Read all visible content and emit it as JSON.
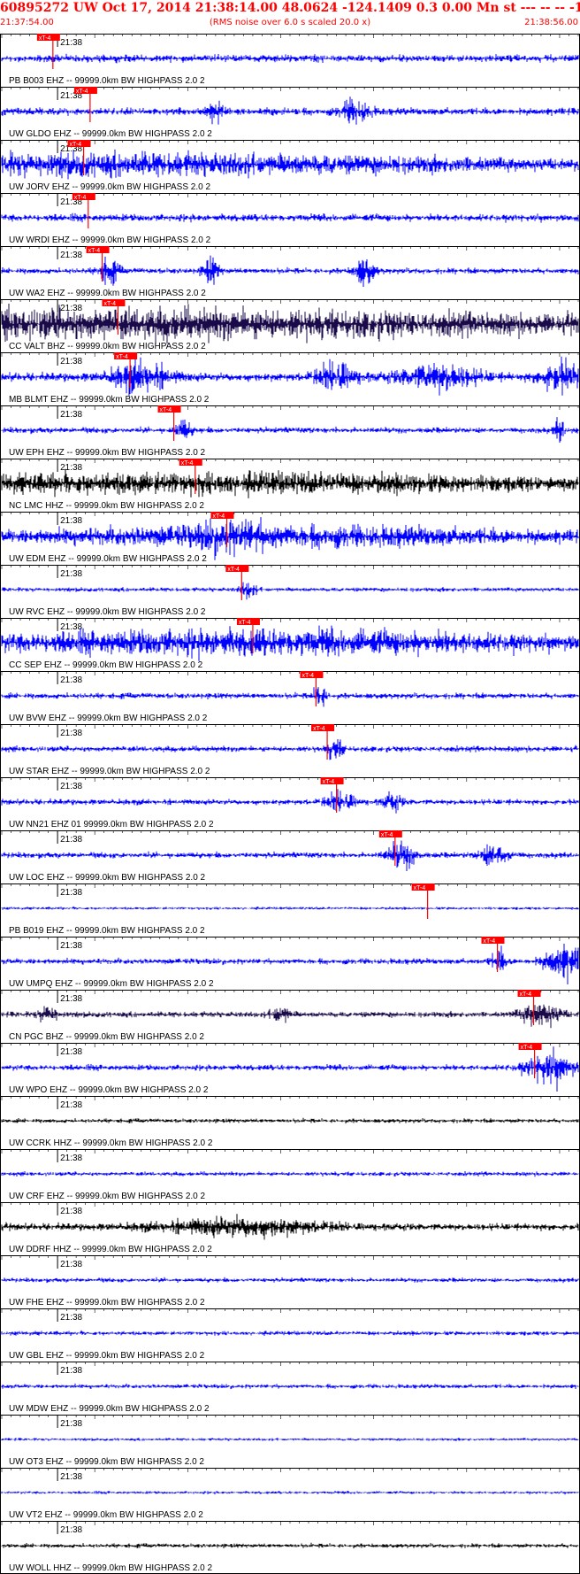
{
  "header": {
    "title": "60895272 UW Oct 17, 2014 21:38:14.00   48.0624 -124.1409  0.3 0.00 Mn st --- -- --  -1",
    "start_time": "21:37:54.00",
    "subtitle": "(RMS noise over 6.0 s scaled 20.0 x)",
    "end_time": "21:38:56.00"
  },
  "chart_data": {
    "type": "seismogram",
    "time_range": [
      "21:37:54.00",
      "21:38:56.00"
    ],
    "time_tick_label": "21:38",
    "pick_label": "xT-4",
    "trace_suffix": "99999.0km BW  HIGHPASS  2.0  2",
    "colors": {
      "blue": "#0000ff",
      "navy": "#1a0a4a",
      "black": "#000000",
      "red": "#ff0000"
    },
    "traces": [
      {
        "station": "PB B003 EHZ --",
        "color": "blue",
        "pick_s": 5.5,
        "amp": 5,
        "bursts": []
      },
      {
        "station": "UW GLDO EHZ --",
        "color": "blue",
        "pick_s": 9.5,
        "amp": 5,
        "bursts": [
          [
            23,
            0.8,
            14
          ],
          [
            38,
            1.5,
            16
          ]
        ]
      },
      {
        "station": "UW JORV EHZ --",
        "color": "blue",
        "pick_s": 8.8,
        "amp": 4,
        "bursts": [
          [
            10,
            50,
            14
          ]
        ]
      },
      {
        "station": "UW WRDI EHZ --",
        "color": "blue",
        "pick_s": 9.3,
        "amp": 5,
        "bursts": []
      },
      {
        "station": "UW WA2 EHZ --",
        "color": "blue",
        "pick_s": 10.8,
        "amp": 4,
        "bursts": [
          [
            11.5,
            1.0,
            18
          ],
          [
            22.5,
            0.8,
            18
          ],
          [
            39,
            1.0,
            20
          ]
        ]
      },
      {
        "station": "CC VALT BHZ --",
        "color": "navy",
        "pick_s": 12.5,
        "amp": 8,
        "bursts": [
          [
            13,
            50,
            16
          ]
        ]
      },
      {
        "station": "MB BLMT EHZ --",
        "color": "blue",
        "pick_s": 13.8,
        "amp": 6,
        "bursts": [
          [
            15,
            3,
            20
          ],
          [
            36,
            2,
            20
          ],
          [
            47,
            4,
            18
          ],
          [
            60,
            2,
            22
          ]
        ]
      },
      {
        "station": "UW EPH EHZ --",
        "color": "blue",
        "pick_s": 18.5,
        "amp": 4,
        "bursts": [
          [
            19.5,
            0.8,
            14
          ],
          [
            60,
            0.5,
            18
          ]
        ]
      },
      {
        "station": "NC LMC HHZ --",
        "color": "black",
        "pick_s": 20.8,
        "amp": 5,
        "bursts": [
          [
            22,
            40,
            12
          ]
        ]
      },
      {
        "station": "UW EDM EHZ --",
        "color": "blue",
        "pick_s": 24.2,
        "amp": 5,
        "bursts": [
          [
            25,
            3,
            18
          ],
          [
            30,
            30,
            12
          ]
        ]
      },
      {
        "station": "UW RVC EHZ --",
        "color": "blue",
        "pick_s": 25.8,
        "amp": 3,
        "bursts": [
          [
            26.5,
            0.8,
            12
          ]
        ]
      },
      {
        "station": "CC SEP EHZ --",
        "color": "blue",
        "pick_s": 27.0,
        "amp": 6,
        "bursts": [
          [
            28,
            34,
            14
          ]
        ]
      },
      {
        "station": "UW BVW EHZ --",
        "color": "blue",
        "pick_s": 33.8,
        "amp": 4,
        "bursts": [
          [
            34.2,
            0.6,
            20
          ]
        ]
      },
      {
        "station": "UW STAR EHZ --",
        "color": "blue",
        "pick_s": 35.0,
        "amp": 4,
        "bursts": [
          [
            35.8,
            0.8,
            16
          ]
        ]
      },
      {
        "station": "UW NN21 EHZ 01",
        "color": "blue",
        "pick_s": 36.0,
        "amp": 4,
        "bursts": [
          [
            36.5,
            1.5,
            14
          ],
          [
            42,
            1.0,
            12
          ]
        ]
      },
      {
        "station": "UW LOC EHZ --",
        "color": "blue",
        "pick_s": 42.3,
        "amp": 4,
        "bursts": [
          [
            43,
            1.5,
            18
          ],
          [
            53,
            1.5,
            16
          ]
        ]
      },
      {
        "station": "PB B019 EHZ --",
        "color": "blue",
        "pick_s": 45.8,
        "amp": 2,
        "bursts": []
      },
      {
        "station": "UW UMPQ EHZ --",
        "color": "blue",
        "pick_s": 53.3,
        "amp": 4,
        "bursts": [
          [
            53.5,
            0.8,
            16
          ],
          [
            60.5,
            2,
            24
          ]
        ]
      },
      {
        "station": "CN PGC BHZ --",
        "color": "navy",
        "pick_s": 57.2,
        "amp": 4,
        "bursts": [
          [
            5,
            1.0,
            12
          ],
          [
            30,
            1.0,
            12
          ],
          [
            58,
            2,
            18
          ]
        ]
      },
      {
        "station": "UW WPO EHZ --",
        "color": "blue",
        "pick_s": 57.3,
        "amp": 4,
        "bursts": [
          [
            59,
            2.5,
            22
          ]
        ]
      },
      {
        "station": "UW CCRK HHZ --",
        "color": "black",
        "pick_s": null,
        "amp": 3,
        "bursts": []
      },
      {
        "station": "UW CRF EHZ --",
        "color": "blue",
        "pick_s": null,
        "amp": 3,
        "bursts": []
      },
      {
        "station": "UW DDRF HHZ --",
        "color": "black",
        "pick_s": null,
        "amp": 5,
        "bursts": [
          [
            26,
            8,
            12
          ]
        ]
      },
      {
        "station": "UW FHE EHZ --",
        "color": "blue",
        "pick_s": null,
        "amp": 3,
        "bursts": []
      },
      {
        "station": "UW GBL EHZ --",
        "color": "blue",
        "pick_s": null,
        "amp": 3,
        "bursts": []
      },
      {
        "station": "UW MDW EHZ --",
        "color": "blue",
        "pick_s": null,
        "amp": 3,
        "bursts": []
      },
      {
        "station": "UW OT3 EHZ --",
        "color": "blue",
        "pick_s": null,
        "amp": 2,
        "bursts": []
      },
      {
        "station": "UW VT2 EHZ --",
        "color": "blue",
        "pick_s": null,
        "amp": 2,
        "bursts": []
      },
      {
        "station": "UW WOLL HHZ --",
        "color": "black",
        "pick_s": null,
        "amp": 3,
        "bursts": []
      }
    ]
  }
}
